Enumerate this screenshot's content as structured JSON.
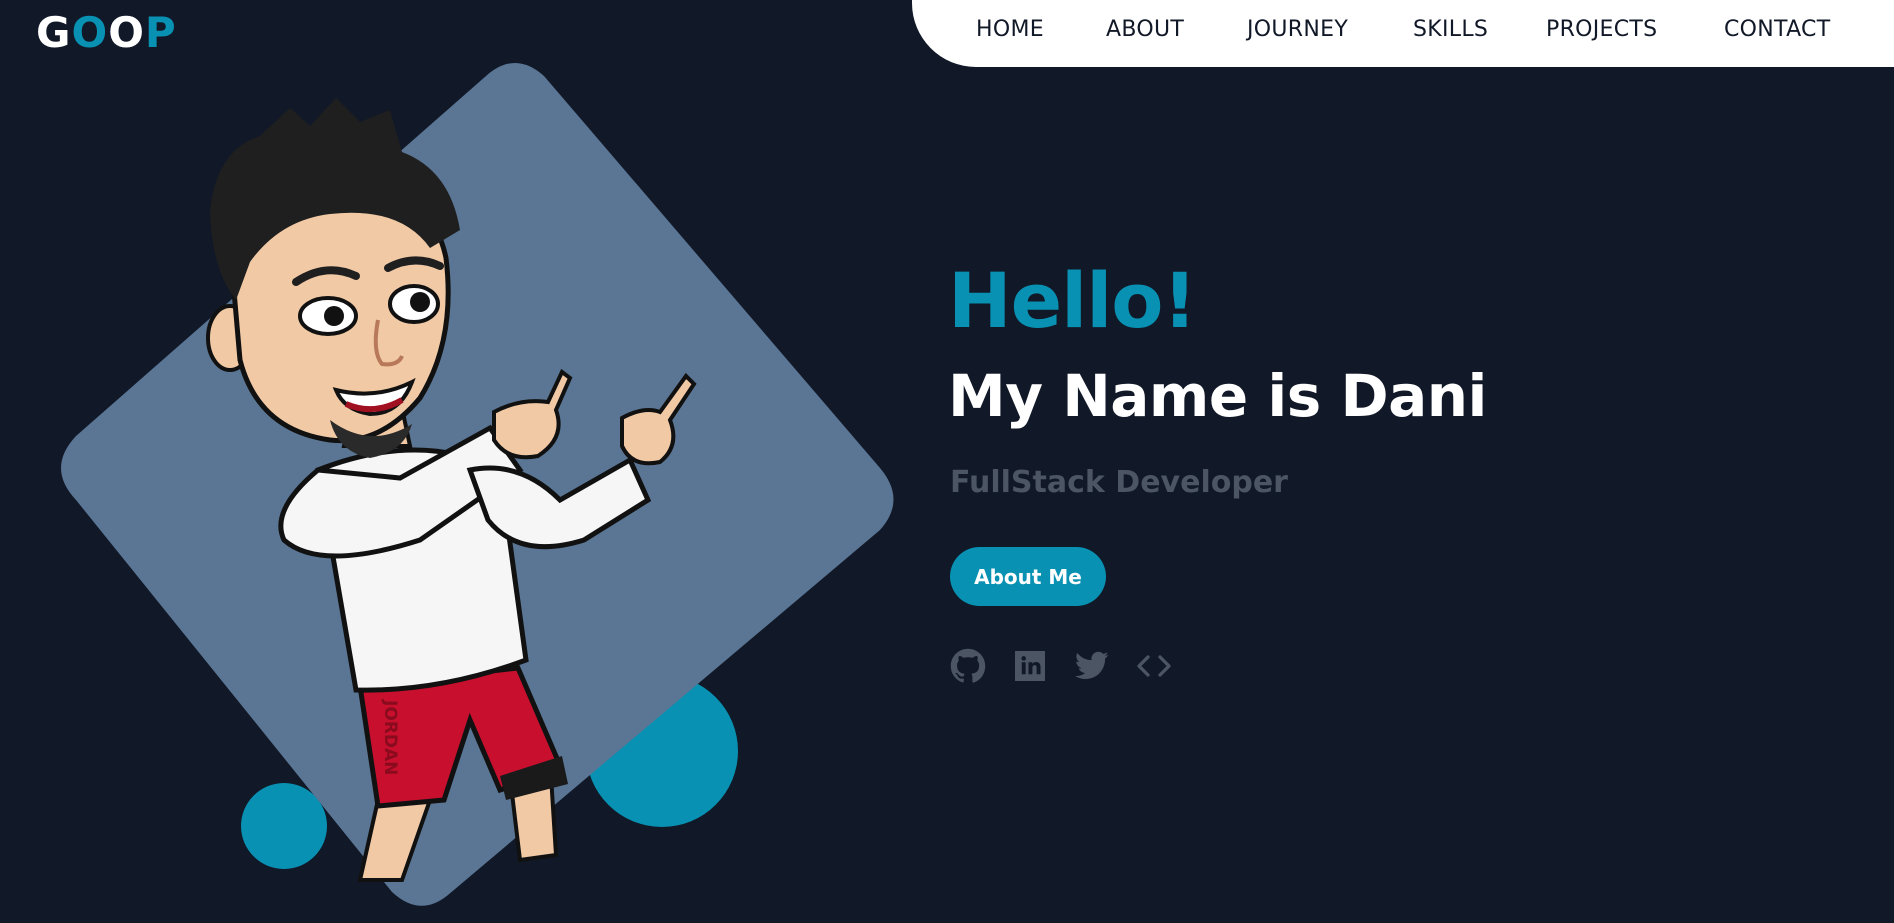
{
  "logo": {
    "letters": [
      "G",
      "O",
      "O",
      "P"
    ],
    "colors": [
      "#ffffff",
      "#0891b2",
      "#ffffff",
      "#0891b2"
    ]
  },
  "nav": {
    "items": [
      {
        "label": "HOME"
      },
      {
        "label": "ABOUT"
      },
      {
        "label": "JOURNEY"
      },
      {
        "label": "SKILLS"
      },
      {
        "label": "PROJECTS"
      },
      {
        "label": "CONTACT"
      }
    ]
  },
  "hero": {
    "greeting": "Hello!",
    "name_line": "My Name is Dani",
    "role": "FullStack Developer",
    "button_label": "About Me",
    "jersey_text": "JORDAN"
  },
  "social": [
    {
      "icon": "github-icon"
    },
    {
      "icon": "linkedin-icon"
    },
    {
      "icon": "twitter-icon"
    },
    {
      "icon": "code-icon"
    }
  ],
  "colors": {
    "background": "#111827",
    "accent": "#0891b2",
    "diamond": "#5a7694",
    "muted": "#4b5563",
    "nav_bg": "#ffffff"
  }
}
